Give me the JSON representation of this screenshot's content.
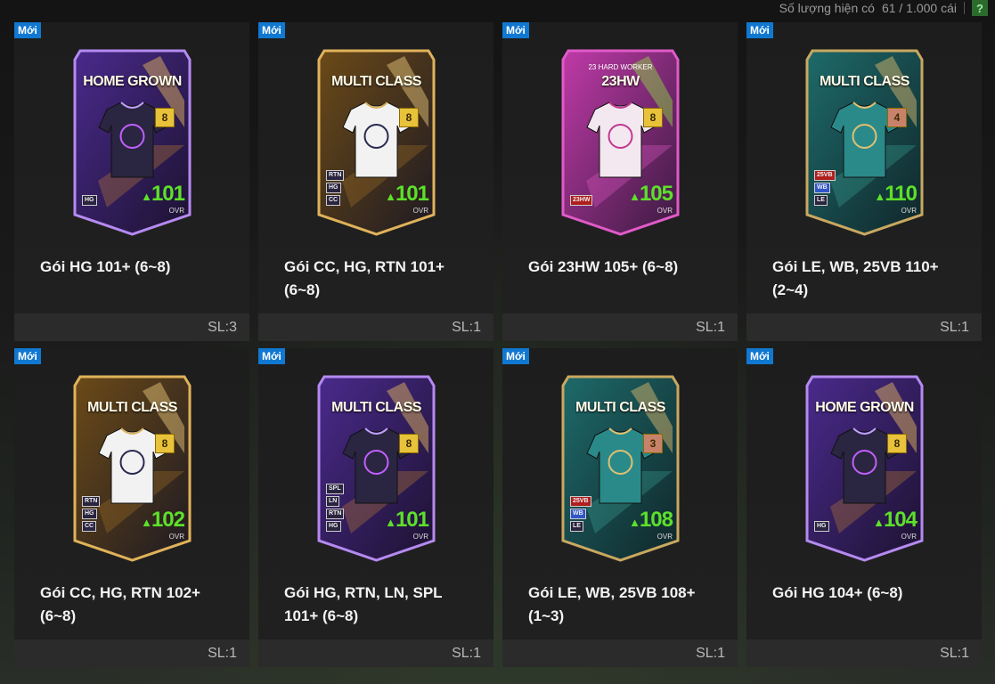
{
  "header": {
    "count_label": "Số lượng hiện có",
    "count_value": "61 / 1.000 cái",
    "help_label": "?"
  },
  "colors": {
    "accent_new": "#1178d1",
    "ovr_green": "#5de02a"
  },
  "packs": [
    {
      "badge": "Mới",
      "card_title": "HOME GROWN",
      "card_subtitle": "",
      "level": "8",
      "level_color": "#e8c23a",
      "ovr": "101",
      "ovr_label": "OVR",
      "tags": [
        "HG"
      ],
      "theme": "purple",
      "shirt": "dark",
      "name": "Gói HG 101+ (6~8)",
      "quantity": "SL:3"
    },
    {
      "badge": "Mới",
      "card_title": "MULTI CLASS",
      "card_subtitle": "",
      "level": "8",
      "level_color": "#e8c23a",
      "ovr": "101",
      "ovr_label": "OVR",
      "tags": [
        "RTN",
        "HG",
        "CC"
      ],
      "theme": "gold",
      "shirt": "white",
      "name": "Gói CC, HG, RTN 101+ (6~8)",
      "quantity": "SL:1"
    },
    {
      "badge": "Mới",
      "card_title": "23HW",
      "card_subtitle": "23 HARD WORKER",
      "level": "8",
      "level_color": "#e8c23a",
      "ovr": "105",
      "ovr_label": "OVR",
      "tags": [
        "23HW"
      ],
      "theme": "pink",
      "shirt": "lightpink",
      "name": "Gói 23HW 105+ (6~8)",
      "quantity": "SL:1"
    },
    {
      "badge": "Mới",
      "card_title": "MULTI CLASS",
      "card_subtitle": "",
      "level": "4",
      "level_color": "#c9826a",
      "ovr": "110",
      "ovr_label": "OVR",
      "tags": [
        "25VB",
        "WB",
        "LE"
      ],
      "theme": "teal",
      "shirt": "teal",
      "name": "Gói LE, WB, 25VB 110+ (2~4)",
      "quantity": "SL:1"
    },
    {
      "badge": "Mới",
      "card_title": "MULTI CLASS",
      "card_subtitle": "",
      "level": "8",
      "level_color": "#e8c23a",
      "ovr": "102",
      "ovr_label": "OVR",
      "tags": [
        "RTN",
        "HG",
        "CC"
      ],
      "theme": "gold",
      "shirt": "white",
      "name": "Gói CC, HG, RTN 102+ (6~8)",
      "quantity": "SL:1"
    },
    {
      "badge": "Mới",
      "card_title": "MULTI CLASS",
      "card_subtitle": "",
      "level": "8",
      "level_color": "#e8c23a",
      "ovr": "101",
      "ovr_label": "OVR",
      "tags": [
        "SPL",
        "LN",
        "RTN",
        "HG"
      ],
      "theme": "purple",
      "shirt": "dark",
      "name": "Gói HG, RTN, LN, SPL 101+ (6~8)",
      "quantity": "SL:1"
    },
    {
      "badge": "Mới",
      "card_title": "MULTI CLASS",
      "card_subtitle": "",
      "level": "3",
      "level_color": "#c9826a",
      "ovr": "108",
      "ovr_label": "OVR",
      "tags": [
        "25VB",
        "WB",
        "LE"
      ],
      "theme": "teal",
      "shirt": "teal",
      "name": "Gói LE, WB, 25VB 108+ (1~3)",
      "quantity": "SL:1"
    },
    {
      "badge": "Mới",
      "card_title": "HOME GROWN",
      "card_subtitle": "",
      "level": "8",
      "level_color": "#e8c23a",
      "ovr": "104",
      "ovr_label": "OVR",
      "tags": [
        "HG"
      ],
      "theme": "purple",
      "shirt": "dark",
      "name": "Gói HG 104+ (6~8)",
      "quantity": "SL:1"
    }
  ]
}
